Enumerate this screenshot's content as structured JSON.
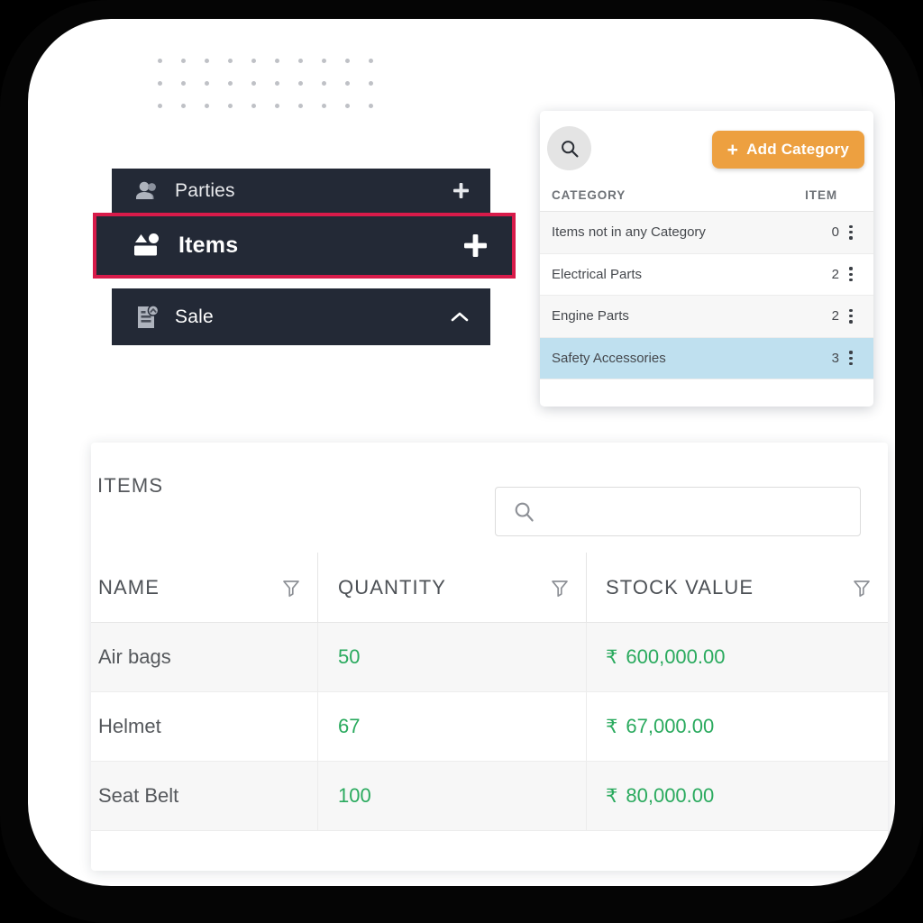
{
  "nav": {
    "items": [
      {
        "label": "Parties",
        "icon": "people-icon",
        "action": "plus-icon"
      },
      {
        "label": "Items",
        "icon": "items-box-icon",
        "action": "plus-icon",
        "selected": true
      },
      {
        "label": "Sale",
        "icon": "invoice-icon",
        "action": "chevron-up-icon"
      }
    ]
  },
  "category_panel": {
    "search_icon": "search-icon",
    "add_button": {
      "label": "Add Category",
      "plus": "+",
      "color": "#eda040"
    },
    "headers": {
      "category": "CATEGORY",
      "item": "ITEM"
    },
    "rows": [
      {
        "name": "Items not in any Category",
        "count": "0",
        "selected": false
      },
      {
        "name": "Electrical Parts",
        "count": "2",
        "selected": false
      },
      {
        "name": "Engine Parts",
        "count": "2",
        "selected": false
      },
      {
        "name": "Safety Accessories",
        "count": "3",
        "selected": true
      }
    ],
    "highlight_color": "#bfe0ef"
  },
  "items_card": {
    "title": "ITEMS",
    "search": {
      "placeholder": "",
      "value": "",
      "icon": "search-icon"
    },
    "columns": [
      {
        "label": "NAME",
        "filter_icon": "filter-icon"
      },
      {
        "label": "QUANTITY",
        "filter_icon": "filter-icon"
      },
      {
        "label": "STOCK VALUE",
        "filter_icon": "filter-icon"
      }
    ],
    "rows": [
      {
        "name": "Air bags",
        "quantity": "50",
        "currency": "₹",
        "stock_value": "600,000.00"
      },
      {
        "name": "Helmet",
        "quantity": "67",
        "currency": "₹",
        "stock_value": "67,000.00"
      },
      {
        "name": "Seat Belt",
        "quantity": "100",
        "currency": "₹",
        "stock_value": "80,000.00"
      }
    ],
    "value_color": "#2aaa5e"
  },
  "decoration": {
    "dot_rows": 3,
    "dot_cols": 10,
    "highlight_border_color": "#d81b4a"
  }
}
